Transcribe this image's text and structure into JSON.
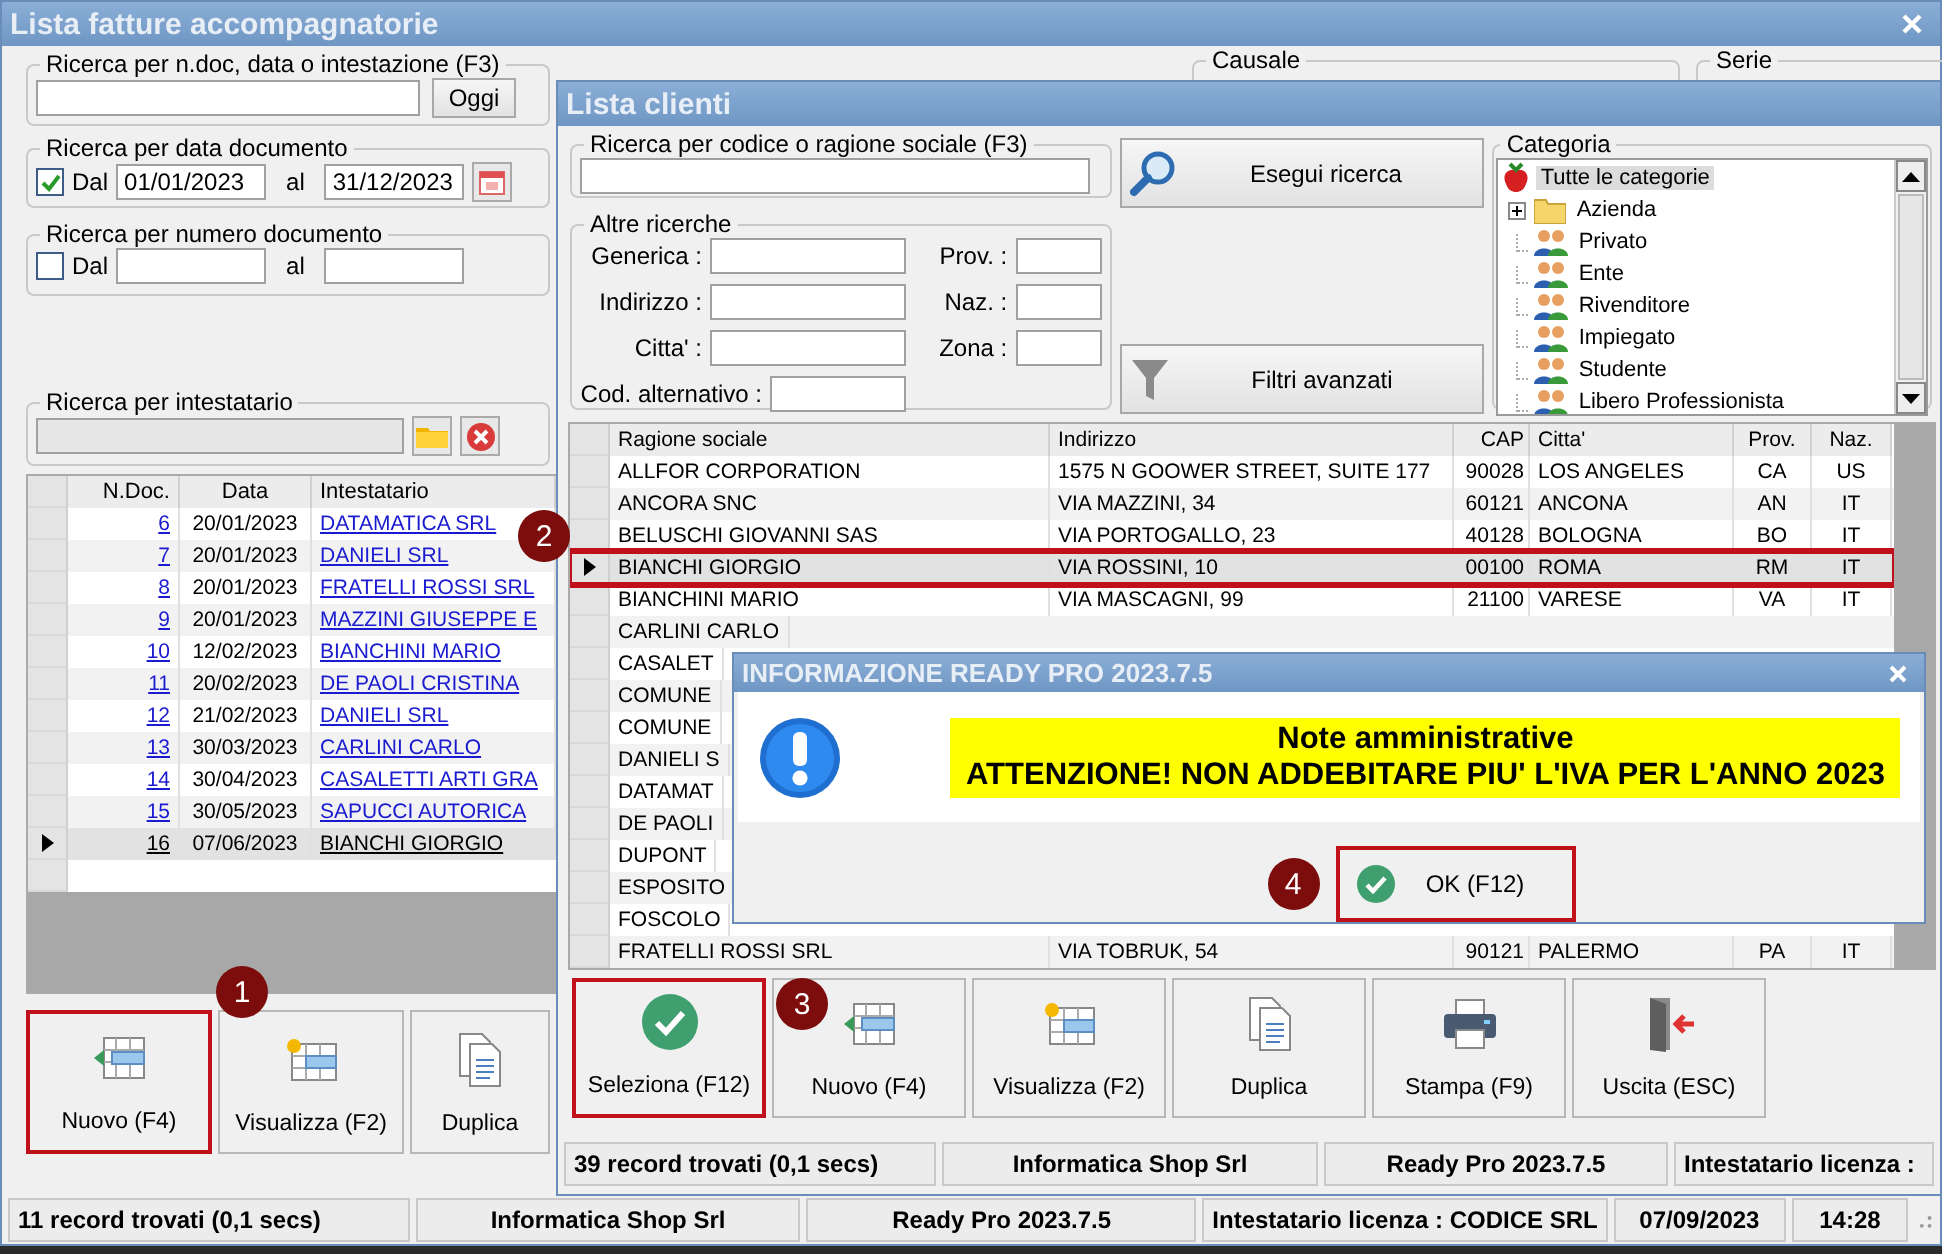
{
  "main_window": {
    "title": "Lista fatture accompagnatorie",
    "text_search": {
      "legend": "Ricerca per n.doc, data o intestazione (F3)",
      "button": "Oggi"
    },
    "date_search": {
      "legend": "Ricerca per data documento",
      "checked": true,
      "from_label": "Dal",
      "from": "01/01/2023",
      "to_label": "al",
      "to": "31/12/2023"
    },
    "number_search": {
      "legend": "Ricerca per numero documento",
      "checked": false,
      "from_label": "Dal",
      "to_label": "al"
    },
    "holder_search": {
      "legend": "Ricerca per intestatario"
    },
    "causale": {
      "legend": "Causale"
    },
    "serie": {
      "legend": "Serie"
    },
    "invoices": {
      "columns": [
        "N.Doc.",
        "Data",
        "Intestatario"
      ],
      "rows": [
        {
          "number": "6",
          "date": "20/01/2023",
          "holder": "DATAMATICA SRL",
          "selected": false
        },
        {
          "number": "7",
          "date": "20/01/2023",
          "holder": "DANIELI SRL",
          "selected": false
        },
        {
          "number": "8",
          "date": "20/01/2023",
          "holder": "FRATELLI ROSSI SRL",
          "selected": false
        },
        {
          "number": "9",
          "date": "20/01/2023",
          "holder": "MAZZINI GIUSEPPE E",
          "selected": false
        },
        {
          "number": "10",
          "date": "12/02/2023",
          "holder": "BIANCHINI MARIO",
          "selected": false
        },
        {
          "number": "11",
          "date": "20/02/2023",
          "holder": "DE PAOLI CRISTINA",
          "selected": false
        },
        {
          "number": "12",
          "date": "21/02/2023",
          "holder": "DANIELI SRL",
          "selected": false
        },
        {
          "number": "13",
          "date": "30/03/2023",
          "holder": "CARLINI CARLO",
          "selected": false
        },
        {
          "number": "14",
          "date": "30/04/2023",
          "holder": "CASALETTI ARTI GRA",
          "selected": false
        },
        {
          "number": "15",
          "date": "30/05/2023",
          "holder": "SAPUCCI AUTORICA",
          "selected": false
        },
        {
          "number": "16",
          "date": "07/06/2023",
          "holder": "BIANCHI GIORGIO",
          "selected": true
        }
      ]
    },
    "buttons": [
      {
        "kind": "new",
        "label": "Nuovo (F4)",
        "highlighted": true,
        "callout": "1"
      },
      {
        "kind": "view",
        "label": "Visualizza (F2)",
        "highlighted": false
      },
      {
        "kind": "duplicate",
        "label": "Duplica",
        "highlighted": false
      }
    ],
    "status_bar": [
      "11 record trovati (0,1 secs)",
      "Informatica Shop Srl",
      "Ready Pro 2023.7.5",
      "Intestatario licenza : CODICE SRL",
      "07/09/2023",
      "14:28"
    ]
  },
  "clients_window": {
    "title": "Lista clienti",
    "search": {
      "legend": "Ricerca per codice o ragione sociale (F3)"
    },
    "search_button": "Esegui ricerca",
    "filters_button": "Filtri avanzati",
    "other": {
      "legend": "Altre ricerche",
      "left_fields": [
        "Generica :",
        "Indirizzo :",
        "Citta' :",
        "Cod. alternativo :"
      ],
      "right_fields": [
        "Prov. :",
        "Naz. :",
        "Zona :"
      ]
    },
    "category": {
      "legend": "Categoria",
      "tree": [
        {
          "label": "Tutte le categorie",
          "kind": "root",
          "selected": true,
          "children": [
            {
              "label": "Azienda",
              "kind": "folder",
              "expanded": false,
              "selected": false
            },
            {
              "label": "Privato",
              "kind": "people",
              "selected": false
            },
            {
              "label": "Ente",
              "kind": "people",
              "selected": false
            },
            {
              "label": "Rivenditore",
              "kind": "people",
              "selected": false
            },
            {
              "label": "Impiegato",
              "kind": "people",
              "selected": false
            },
            {
              "label": "Studente",
              "kind": "people",
              "selected": false
            },
            {
              "label": "Libero Professionista",
              "kind": "people",
              "selected": false
            }
          ]
        }
      ]
    },
    "table": {
      "columns": [
        "Ragione sociale",
        "Indirizzo",
        "CAP",
        "Citta'",
        "Prov.",
        "Naz."
      ],
      "rows": [
        {
          "cells": [
            "ALLFOR CORPORATION",
            "1575 N GOOWER STREET, SUITE 177",
            "90028",
            "LOS ANGELES",
            "CA",
            "US"
          ],
          "selected": false,
          "highlighted": false
        },
        {
          "cells": [
            "ANCORA SNC",
            "VIA MAZZINI, 34",
            "60121",
            "ANCONA",
            "AN",
            "IT"
          ],
          "selected": false,
          "highlighted": false
        },
        {
          "cells": [
            "BELUSCHI GIOVANNI SAS",
            "VIA PORTOGALLO, 23",
            "40128",
            "BOLOGNA",
            "BO",
            "IT"
          ],
          "selected": false,
          "highlighted": false
        },
        {
          "cells": [
            "BIANCHI GIORGIO",
            "VIA ROSSINI, 10",
            "00100",
            "ROMA",
            "RM",
            "IT"
          ],
          "selected": true,
          "highlighted": true,
          "callout": "2"
        },
        {
          "cells": [
            "BIANCHINI MARIO",
            "VIA MASCAGNI, 99",
            "21100",
            "VARESE",
            "VA",
            "IT"
          ],
          "selected": false,
          "highlighted": false
        },
        {
          "cells": [
            "CARLINI CARLO"
          ],
          "selected": false,
          "highlighted": false
        },
        {
          "cells": [
            "CASALET"
          ],
          "selected": false,
          "highlighted": false
        },
        {
          "cells": [
            "COMUNE"
          ],
          "selected": false,
          "highlighted": false
        },
        {
          "cells": [
            "COMUNE"
          ],
          "selected": false,
          "highlighted": false
        },
        {
          "cells": [
            "DANIELI S"
          ],
          "selected": false,
          "highlighted": false
        },
        {
          "cells": [
            "DATAMAT"
          ],
          "selected": false,
          "highlighted": false
        },
        {
          "cells": [
            "DE PAOLI"
          ],
          "selected": false,
          "highlighted": false
        },
        {
          "cells": [
            "DUPONT"
          ],
          "selected": false,
          "highlighted": false
        },
        {
          "cells": [
            "ESPOSITO"
          ],
          "selected": false,
          "highlighted": false
        },
        {
          "cells": [
            "FOSCOLO"
          ],
          "selected": false,
          "highlighted": false
        },
        {
          "cells": [
            "FRATELLI ROSSI SRL",
            "VIA TOBRUK, 54",
            "90121",
            "PALERMO",
            "PA",
            "IT"
          ],
          "selected": false,
          "highlighted": false
        }
      ]
    },
    "buttons": [
      {
        "kind": "select",
        "label": "Seleziona (F12)",
        "highlighted": true,
        "callout": "3"
      },
      {
        "kind": "new",
        "label": "Nuovo (F4)",
        "highlighted": false
      },
      {
        "kind": "view",
        "label": "Visualizza (F2)",
        "highlighted": false
      },
      {
        "kind": "duplicate",
        "label": "Duplica",
        "highlighted": false
      },
      {
        "kind": "print",
        "label": "Stampa (F9)",
        "highlighted": false
      },
      {
        "kind": "exit",
        "label": "Uscita (ESC)",
        "highlighted": false
      }
    ],
    "status_bar": [
      "39 record trovati (0,1 secs)",
      "Informatica Shop Srl",
      "Ready Pro 2023.7.5",
      "Intestatario licenza :"
    ]
  },
  "dialog": {
    "title": "INFORMAZIONE READY PRO 2023.7.5",
    "heading": "Note amministrative",
    "message": "ATTENZIONE! NON ADDEBITARE PIU' L'IVA PER L'ANNO 2023",
    "button": {
      "label": "OK (F12)",
      "highlighted": true,
      "callout": "4"
    }
  }
}
